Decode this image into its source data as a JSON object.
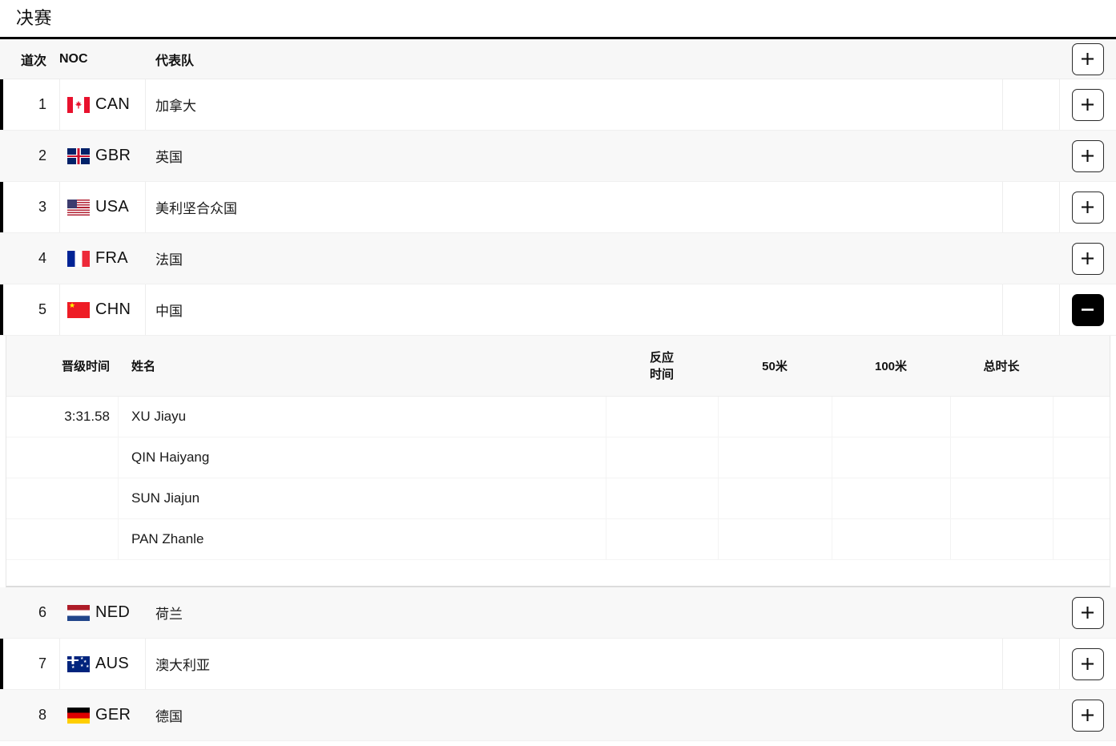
{
  "page": {
    "title": "决赛"
  },
  "table": {
    "headers": {
      "lane": "道次",
      "noc": "NOC",
      "team": "代表队"
    },
    "rows": [
      {
        "lane": "1",
        "noc": "CAN",
        "team": "加拿大",
        "flag": "flag-CAN",
        "action": "expand",
        "action_label": "+",
        "stripe": "white"
      },
      {
        "lane": "2",
        "noc": "GBR",
        "team": "英国",
        "flag": "flag-GBR",
        "action": "expand",
        "action_label": "+",
        "stripe": "gray"
      },
      {
        "lane": "3",
        "noc": "USA",
        "team": "美利坚合众国",
        "flag": "flag-USA",
        "action": "expand",
        "action_label": "+",
        "stripe": "white"
      },
      {
        "lane": "4",
        "noc": "FRA",
        "team": "法国",
        "flag": "flag-FRA",
        "action": "expand",
        "action_label": "+",
        "stripe": "gray"
      },
      {
        "lane": "5",
        "noc": "CHN",
        "team": "中国",
        "flag": "flag-CHN",
        "action": "collapse",
        "action_label": "−",
        "stripe": "white"
      },
      {
        "lane": "6",
        "noc": "NED",
        "team": "荷兰",
        "flag": "flag-NED",
        "action": "expand",
        "action_label": "+",
        "stripe": "gray"
      },
      {
        "lane": "7",
        "noc": "AUS",
        "team": "澳大利亚",
        "flag": "flag-AUS",
        "action": "expand",
        "action_label": "+",
        "stripe": "white"
      },
      {
        "lane": "8",
        "noc": "GER",
        "team": "德国",
        "flag": "flag-GER",
        "action": "expand",
        "action_label": "+",
        "stripe": "gray"
      }
    ]
  },
  "expanded": {
    "for_lane": "5",
    "headers": {
      "qualify_time": "晋级时间",
      "name": "姓名",
      "reaction_time_l1": "反应",
      "reaction_time_l2": "时间",
      "split_50": "50米",
      "split_100": "100米",
      "total": "总时长"
    },
    "athletes": [
      {
        "time": "3:31.58",
        "name": "XU Jiayu",
        "reaction": "",
        "split50": "",
        "split100": "",
        "total": ""
      },
      {
        "time": "",
        "name": "QIN Haiyang",
        "reaction": "",
        "split50": "",
        "split100": "",
        "total": ""
      },
      {
        "time": "",
        "name": "SUN Jiajun",
        "reaction": "",
        "split50": "",
        "split100": "",
        "total": ""
      },
      {
        "time": "",
        "name": "PAN Zhanle",
        "reaction": "",
        "split50": "",
        "split100": "",
        "total": ""
      }
    ]
  },
  "colors": {
    "accent": "#000000",
    "row_white": "#ffffff",
    "row_gray": "#f8f8f8",
    "header_bg": "#f7f7f7"
  }
}
